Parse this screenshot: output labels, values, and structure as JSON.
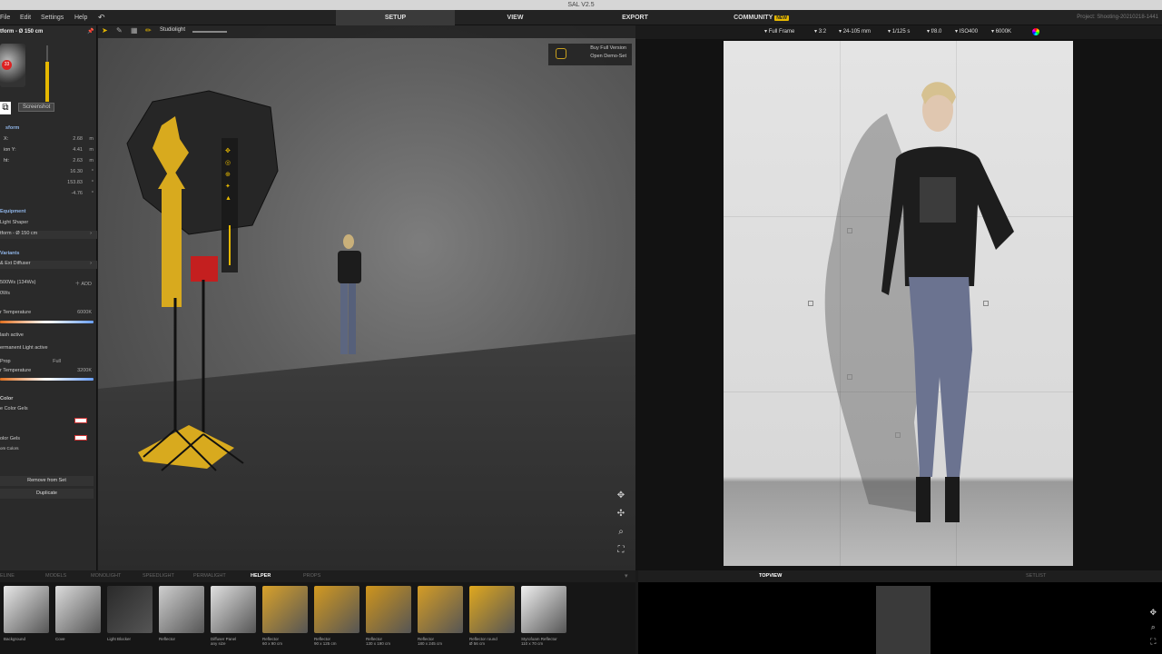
{
  "window": {
    "title": "SAL V2.5"
  },
  "menu": {
    "file": "File",
    "edit": "Edit",
    "settings": "Settings",
    "help": "Help"
  },
  "main_tabs": [
    {
      "label": "SETUP",
      "active": true
    },
    {
      "label": "VIEW",
      "active": false
    },
    {
      "label": "EXPORT",
      "active": false
    },
    {
      "label": "COMMUNITY",
      "badge": "NEW",
      "active": false
    }
  ],
  "project": "Project: Shooting-20210218-1441",
  "left_panel": {
    "object_title": "tform - Ø 150 cm",
    "tooltip": "Screenshot",
    "section_transform": "sform",
    "transform": [
      {
        "label": "X:",
        "value": "2.68",
        "unit": "m"
      },
      {
        "label": "ion Y:",
        "value": "4.41",
        "unit": "m"
      },
      {
        "label": "ht:",
        "value": "2.63",
        "unit": "m"
      },
      {
        "label": "",
        "value": "16.30",
        "unit": "°"
      },
      {
        "label": "",
        "value": "153.83",
        "unit": "°"
      },
      {
        "label": "",
        "value": "-4.76",
        "unit": "°"
      }
    ],
    "equipment_head": "Equipment",
    "light_shaper_label": "Light Shaper",
    "light_shaper_value": "tform - Ø 150 cm",
    "variants_head": "Variants",
    "variant_value": "& Ext Diffuser",
    "power_value": "500Ws (134Ws)",
    "add_label": "ADD",
    "power_sub": "0Ws",
    "temp_label": "r Temperature",
    "temp_value": "6000K",
    "flash_active": "lash active",
    "permanent_active": "ermanent Light active",
    "prop_label": "Prop",
    "prop_value": "Full",
    "temp2_label": "r Temperature",
    "temp2_value": "3200K",
    "color_head": "Color",
    "color_gels_label": "e Color Gels",
    "color_gels2_label": "olor Gels",
    "om_colors": "om Colors",
    "remove_button": "Remove from Set",
    "duplicate_button": "Duplicate"
  },
  "viewport": {
    "studio_label": "Studiolight",
    "buy_full": "Buy Full Version",
    "open_demo": "Open Demo-Set"
  },
  "camera_bar": {
    "frame": "Full Frame",
    "ratio": "3:2",
    "lens": "24-105 mm",
    "shutter": "1/125 s",
    "aperture": "f/8.0",
    "iso": "ISO400",
    "wb": "6000K"
  },
  "bottom_tabs": [
    {
      "label": "ELINE",
      "active": false
    },
    {
      "label": "MODELS",
      "active": false
    },
    {
      "label": "MONOLIGHT",
      "active": false
    },
    {
      "label": "SPEEDLIGHT",
      "active": false
    },
    {
      "label": "PERMALIGHT",
      "active": false
    },
    {
      "label": "HELPER",
      "active": true
    },
    {
      "label": "PROPS",
      "active": false
    }
  ],
  "thumbs": [
    {
      "name": "Background",
      "size": "",
      "color": "#e8e8e8"
    },
    {
      "name": "Cove",
      "size": "",
      "color": "#dcdcdc"
    },
    {
      "name": "Light Blocker",
      "size": "",
      "color": "#2a2a2a"
    },
    {
      "name": "Reflector",
      "size": "",
      "color": "#cfcfcf"
    },
    {
      "name": "Diffuser Panel",
      "size": "any size",
      "color": "#e0e0e0"
    },
    {
      "name": "Reflector",
      "size": "60 x 90 cm",
      "color": "#d9a22a"
    },
    {
      "name": "Reflector",
      "size": "90 x 125 cm",
      "color": "#d39a20"
    },
    {
      "name": "Reflector",
      "size": "130 x 190 cm",
      "color": "#cf951c"
    },
    {
      "name": "Reflector",
      "size": "180 x 245 cm",
      "color": "#d59d25"
    },
    {
      "name": "Reflector round",
      "size": "Ø 56 cm",
      "color": "#e0a81e"
    },
    {
      "name": "Styrofoam Reflector",
      "size": "110 x 70 cm",
      "color": "#f0f0f0"
    }
  ],
  "topview_label": "TOPVIEW",
  "setlist_label": "SETLIST",
  "colors": {
    "accent_yellow": "#e6b800",
    "panel": "#2a2a2a",
    "active_tab": "#3a3a3a"
  }
}
